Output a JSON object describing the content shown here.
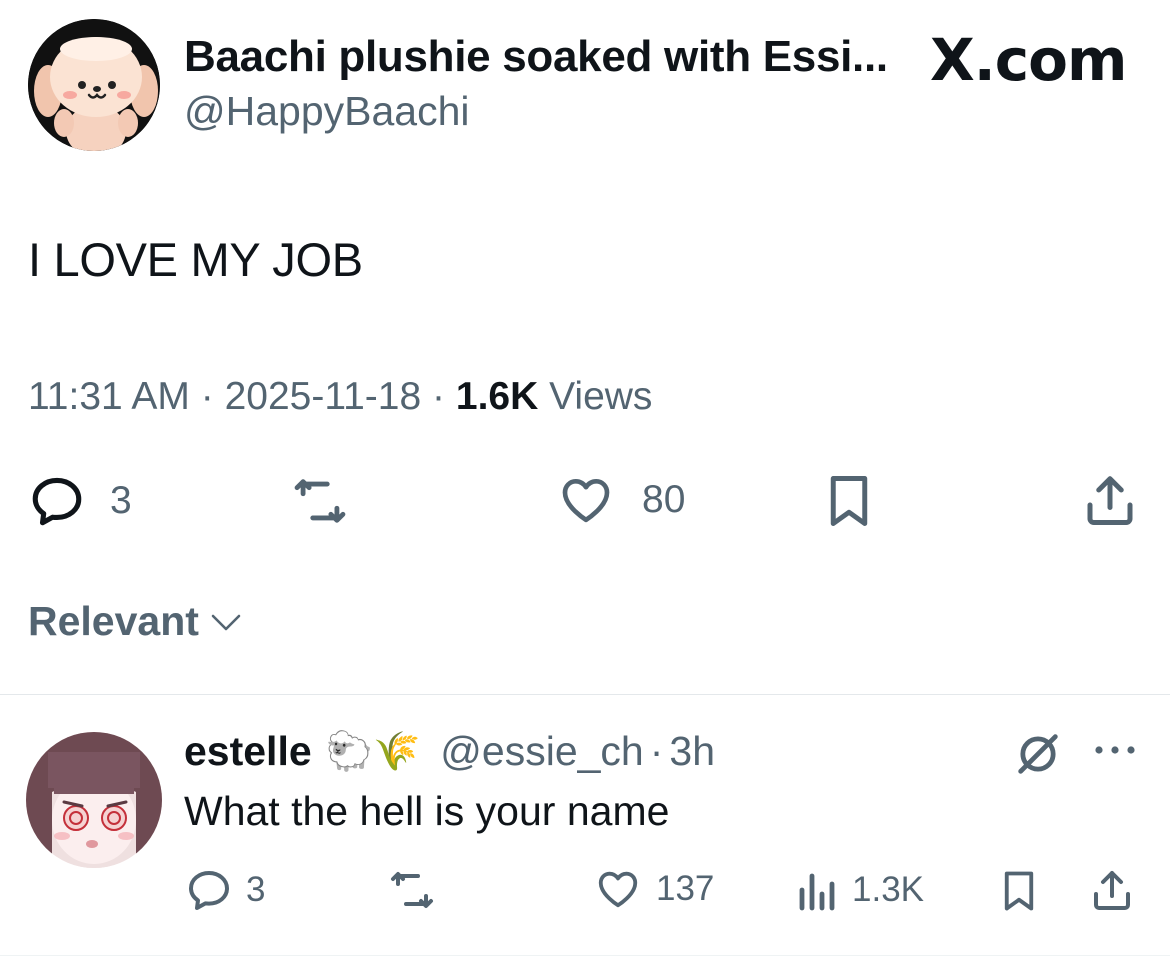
{
  "post": {
    "author_name": "Baachi plushie soaked with Essi...",
    "author_handle": "@HappyBaachi",
    "brand": "X.com",
    "text": "I LOVE MY JOB",
    "time": "11:31 AM",
    "date": "2025-11-18",
    "views_count": "1.6K",
    "views_label": "Views",
    "separator": "·",
    "replies": "3",
    "likes": "80"
  },
  "sort": {
    "label": "Relevant"
  },
  "reply": {
    "name": "estelle",
    "emoji": "🐑🌾",
    "handle": "@essie_ch",
    "separator": "·",
    "time": "3h",
    "text": "What the hell is your name",
    "replies": "3",
    "likes": "137",
    "views": "1.3K"
  },
  "colors": {
    "text": "#0f1419",
    "muted": "#536471",
    "divider": "#e4e8eb"
  },
  "icons": [
    "reply-icon",
    "retweet-icon",
    "like-icon",
    "bookmark-icon",
    "share-icon",
    "views-icon",
    "grok-icon",
    "more-icon",
    "chevron-down-icon"
  ]
}
